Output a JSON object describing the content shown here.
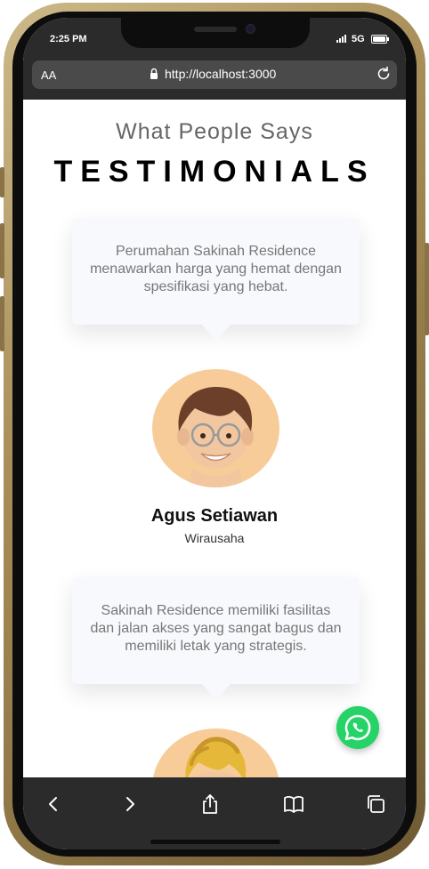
{
  "status": {
    "time": "2:25 PM",
    "network": "5G"
  },
  "browser": {
    "text_size_label": "AA",
    "url": "http://localhost:3000"
  },
  "page": {
    "subtitle": "What People Says",
    "title": "TESTIMONIALS",
    "testimonials": [
      {
        "quote": "Perumahan Sakinah Residence menawarkan harga yang hemat dengan spesifikasi yang hebat.",
        "name": "Agus Setiawan",
        "role": "Wirausaha"
      },
      {
        "quote": "Sakinah Residence memiliki fasilitas dan jalan akses yang sangat bagus dan memiliki letak yang strategis."
      }
    ]
  },
  "icons": {
    "back": "chevron-left-icon",
    "forward": "chevron-right-icon",
    "share": "share-icon",
    "bookmarks": "book-icon",
    "tabs": "tabs-icon",
    "whatsapp": "whatsapp-icon"
  },
  "colors": {
    "avatar_bg": "#f7cc98",
    "whatsapp": "#25d366",
    "browser_chrome": "#2b2b2b"
  }
}
